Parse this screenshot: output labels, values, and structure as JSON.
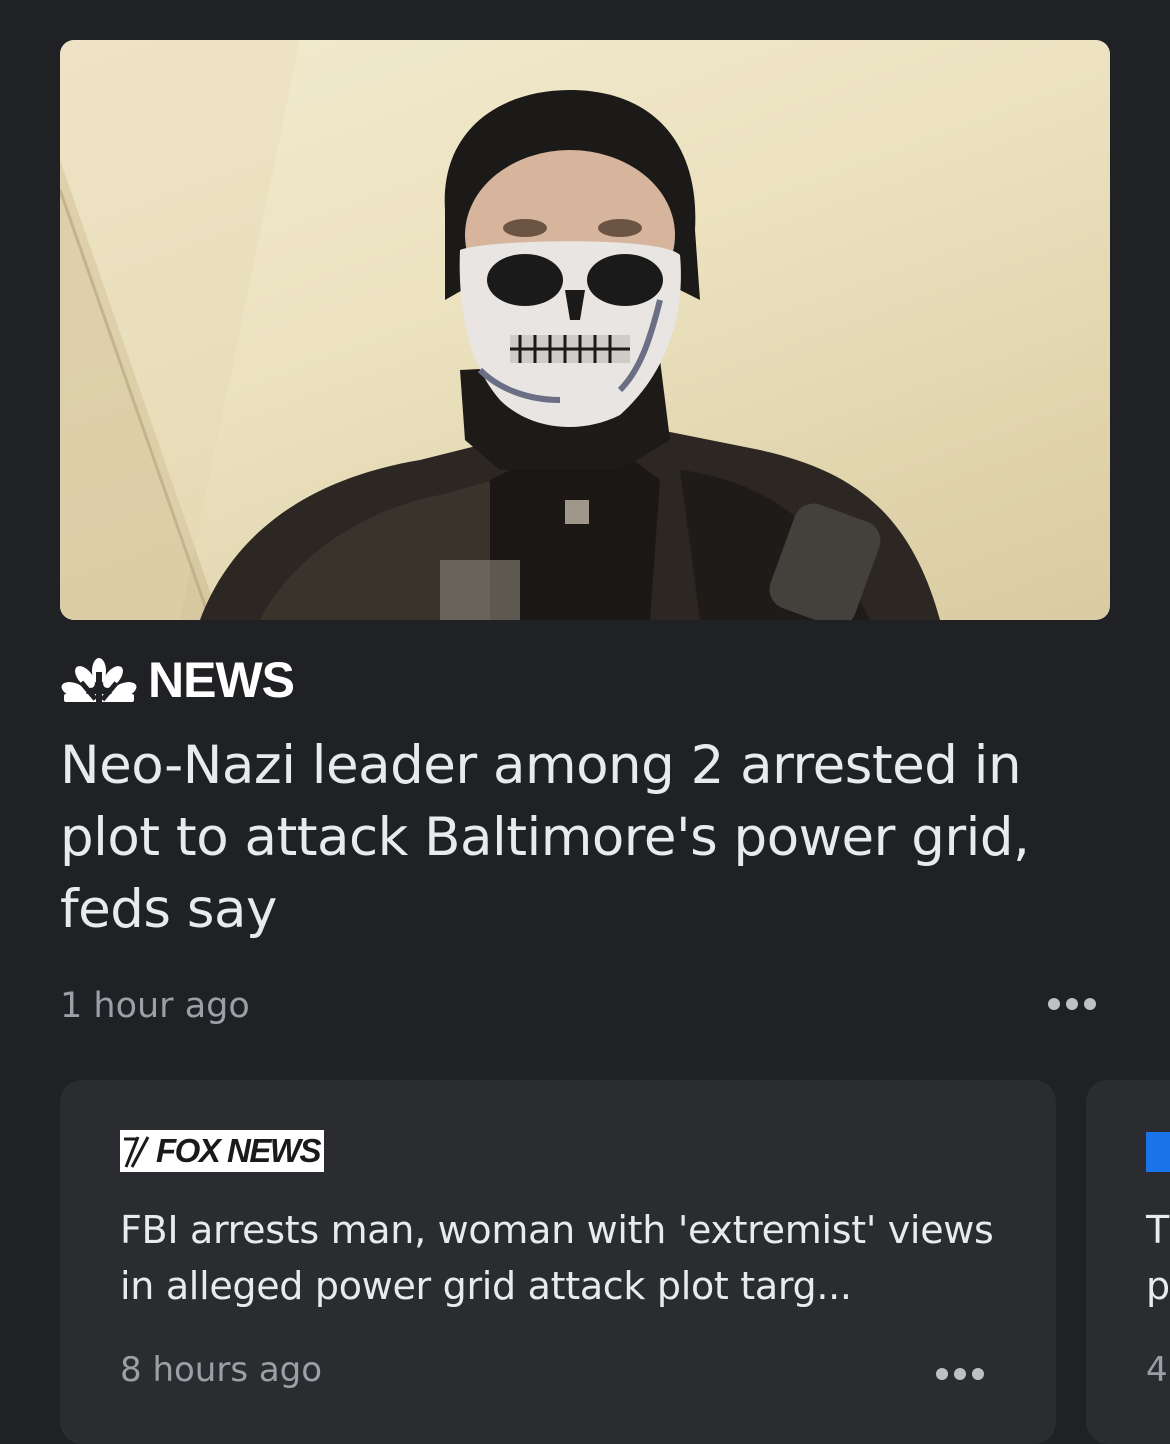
{
  "main_story": {
    "source": "NEWS",
    "source_logo": "nbc-peacock-logo",
    "headline": "Neo-Nazi leader among 2 arrested in plot to attack Baltimore's power grid, feds say",
    "time": "1 hour ago",
    "more_icon": "more-horizontal-icon"
  },
  "related_stories": [
    {
      "source": "FOX NEWS",
      "headline": "FBI arrests man, woman with 'extremist' views in alleged power grid attack plot targ...",
      "time": "8 hours ago",
      "more_icon": "more-horizontal-icon"
    },
    {
      "source_logo": "msnbc-logo",
      "headline_line1": "T",
      "headline_line2": "p",
      "time": "4"
    }
  ],
  "colors": {
    "background": "#202124",
    "card": "#2b2c30",
    "text_primary": "#e8eaed",
    "text_secondary": "#9aa0a6",
    "msnbc_blue": "#1a73e8"
  }
}
